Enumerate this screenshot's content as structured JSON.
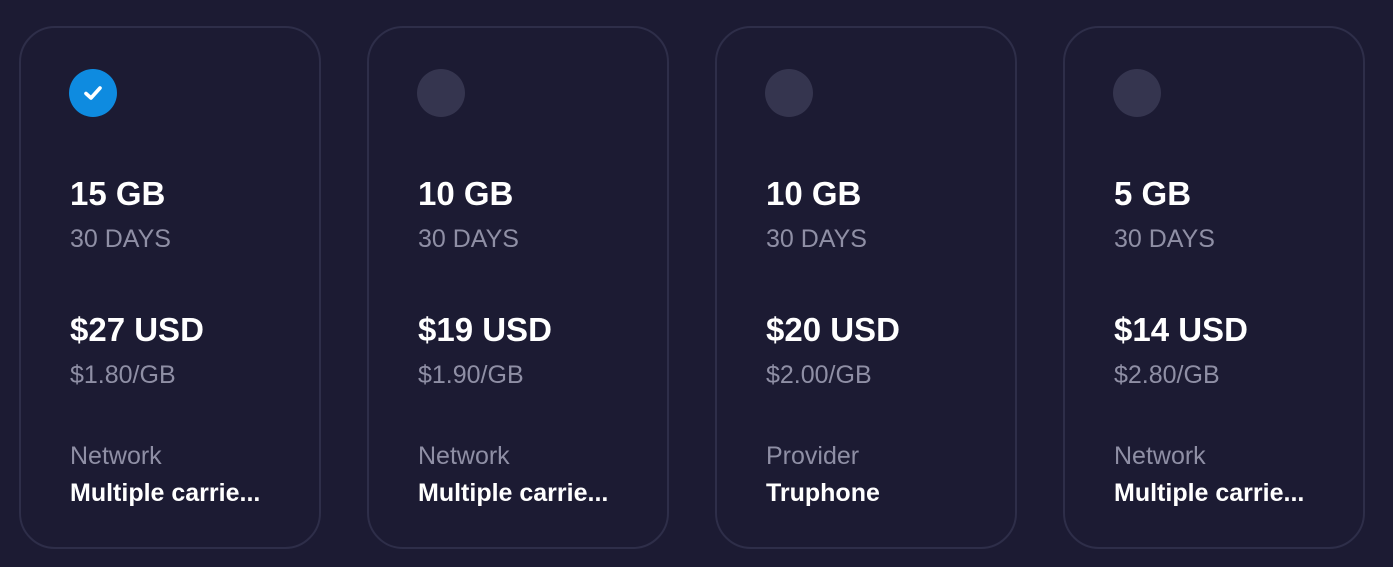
{
  "colors": {
    "background": "#1c1b33",
    "card_border": "#2e2e49",
    "radio_unselected": "#35354f",
    "radio_selected": "#0e8be0",
    "primary_text": "#ffffff",
    "secondary_text": "#8f8fa5"
  },
  "plans": [
    {
      "selected": true,
      "radio_icon": "checkmark-icon",
      "data": "15 GB",
      "duration": "30 DAYS",
      "price": "$27 USD",
      "per_gb": "$1.80/GB",
      "meta_label": "Network",
      "meta_value": "Multiple carrie..."
    },
    {
      "selected": false,
      "data": "10 GB",
      "duration": "30 DAYS",
      "price": "$19 USD",
      "per_gb": "$1.90/GB",
      "meta_label": "Network",
      "meta_value": "Multiple carrie..."
    },
    {
      "selected": false,
      "data": "10 GB",
      "duration": "30 DAYS",
      "price": "$20 USD",
      "per_gb": "$2.00/GB",
      "meta_label": "Provider",
      "meta_value": "Truphone"
    },
    {
      "selected": false,
      "data": "5 GB",
      "duration": "30 DAYS",
      "price": "$14 USD",
      "per_gb": "$2.80/GB",
      "meta_label": "Network",
      "meta_value": "Multiple carrie..."
    }
  ]
}
